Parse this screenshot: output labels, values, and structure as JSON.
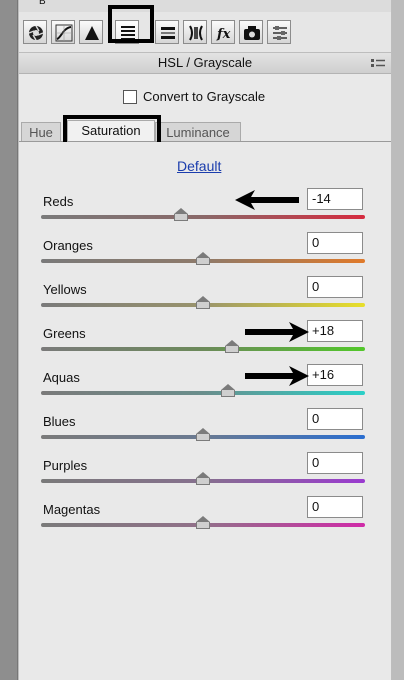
{
  "top_strip_fragment": "B",
  "panel": {
    "title": "HSL / Grayscale",
    "convert_label": "Convert to Grayscale",
    "convert_checked": false
  },
  "tabs": [
    {
      "label": "Hue",
      "active": false
    },
    {
      "label": "Saturation",
      "active": true
    },
    {
      "label": "Luminance",
      "active": false
    }
  ],
  "default_link": "Default",
  "sliders": [
    {
      "label": "Reds",
      "value": "-14"
    },
    {
      "label": "Oranges",
      "value": "0"
    },
    {
      "label": "Yellows",
      "value": "0"
    },
    {
      "label": "Greens",
      "value": "+18"
    },
    {
      "label": "Aquas",
      "value": "+16"
    },
    {
      "label": "Blues",
      "value": "0"
    },
    {
      "label": "Purples",
      "value": "0"
    },
    {
      "label": "Magentas",
      "value": "0"
    }
  ],
  "toolbar_icons": [
    "basic-aperture-icon",
    "tone-curve-icon",
    "detail-triangle-icon",
    "hsl-grayscale-icon",
    "split-toning-icon",
    "lens-corrections-icon",
    "effects-fx-icon",
    "camera-calibration-icon",
    "presets-sliders-icon"
  ],
  "colors": {
    "panel_bg": "#e9e9e9",
    "link": "#1b3dad",
    "callout": "#000000"
  }
}
